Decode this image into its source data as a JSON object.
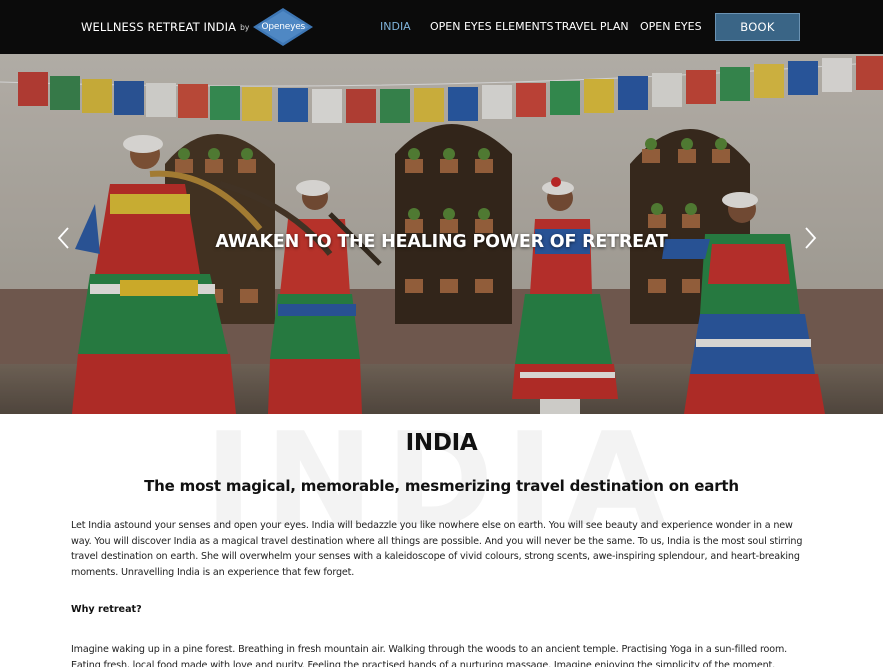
{
  "header": {
    "brand_name": "WELLNESS RETREAT INDIA",
    "brand_by": "by",
    "logo_text": "Openeyes",
    "nav": [
      {
        "label": "INDIA",
        "active": true
      },
      {
        "label": "OPEN EYES ELEMENTS",
        "active": false
      },
      {
        "label": "TRAVEL PLAN",
        "active": false
      },
      {
        "label": "OPEN EYES",
        "active": false
      }
    ],
    "book_label": "BOOK"
  },
  "hero": {
    "headline": "AWAKEN TO THE HEALING POWER OF RETREAT",
    "prev_icon": "chevron-left-icon",
    "next_icon": "chevron-right-icon"
  },
  "content": {
    "watermark": "INDIA",
    "title": "INDIA",
    "subtitle": "The most magical, memorable, mesmerizing travel destination on earth",
    "paragraph1": "Let India astound your senses and open your eyes. India will bedazzle you like nowhere else on earth. You will see beauty and experience wonder in a new way. You will discover India as a magical travel destination where all things are possible. And you will never be the same. To us, India is the most soul stirring travel destination on earth. She will overwhelm your senses with a kaleidoscope of vivid colours, strong scents, awe-inspiring splendour, and heart-breaking moments. Unravelling India is an experience that few forget.",
    "why_heading": "Why retreat?",
    "paragraph2": "Imagine waking up in a pine forest. Breathing in fresh mountain air. Walking through the woods to an ancient temple. Practising Yoga in a sun-filled room. Eating fresh, local food made with love and purity. Feeling the practised hands of a nurturing massage. Imagine enjoying the simplicity of the moment."
  },
  "colors": {
    "header_bg": "#0b0b0b",
    "nav_active": "#7fb3da",
    "book_bg": "#3a6586",
    "logo_blue": "#3e77b5"
  }
}
